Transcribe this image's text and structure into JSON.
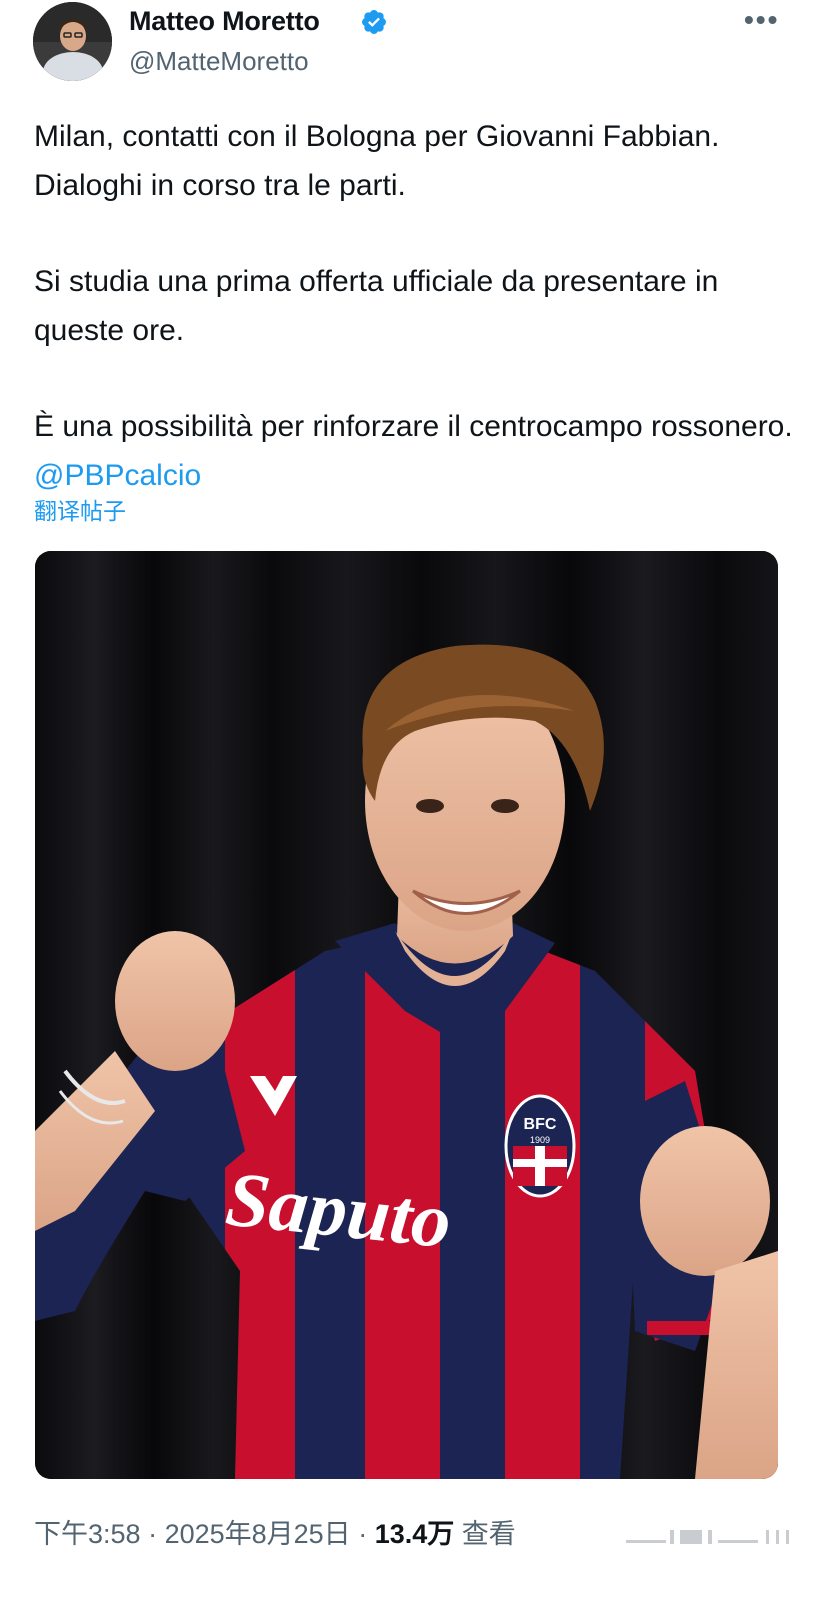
{
  "author": {
    "display_name": "Matteo Moretto",
    "handle": "@MatteMoretto",
    "verified": true,
    "verified_icon": "verified-badge-icon",
    "more_icon": "more-options-icon"
  },
  "tweet": {
    "paragraphs": [
      "Milan, contatti con il Bologna per Giovanni Fabbian. Dialoghi in corso tra le parti.",
      "Si studia una prima offerta ufficiale da presentare in queste ore.",
      "È una possibilità per rinforzare il centrocampo rossonero."
    ],
    "mention": "@PBPcalcio",
    "translate_label": "翻译帖子"
  },
  "media": {
    "sponsor_text": "Saputo",
    "crest_text": "BFC",
    "crest_year": "1909"
  },
  "meta": {
    "time": "下午3:58",
    "separator": " · ",
    "date": "2025年8月25日",
    "views_count": "13.4万",
    "views_label": "查看"
  },
  "colors": {
    "link": "#1d9bf0",
    "secondary_text": "#536471",
    "primary_text": "#0f1419",
    "jersey_red": "#c8102e",
    "jersey_navy": "#1b2452"
  }
}
